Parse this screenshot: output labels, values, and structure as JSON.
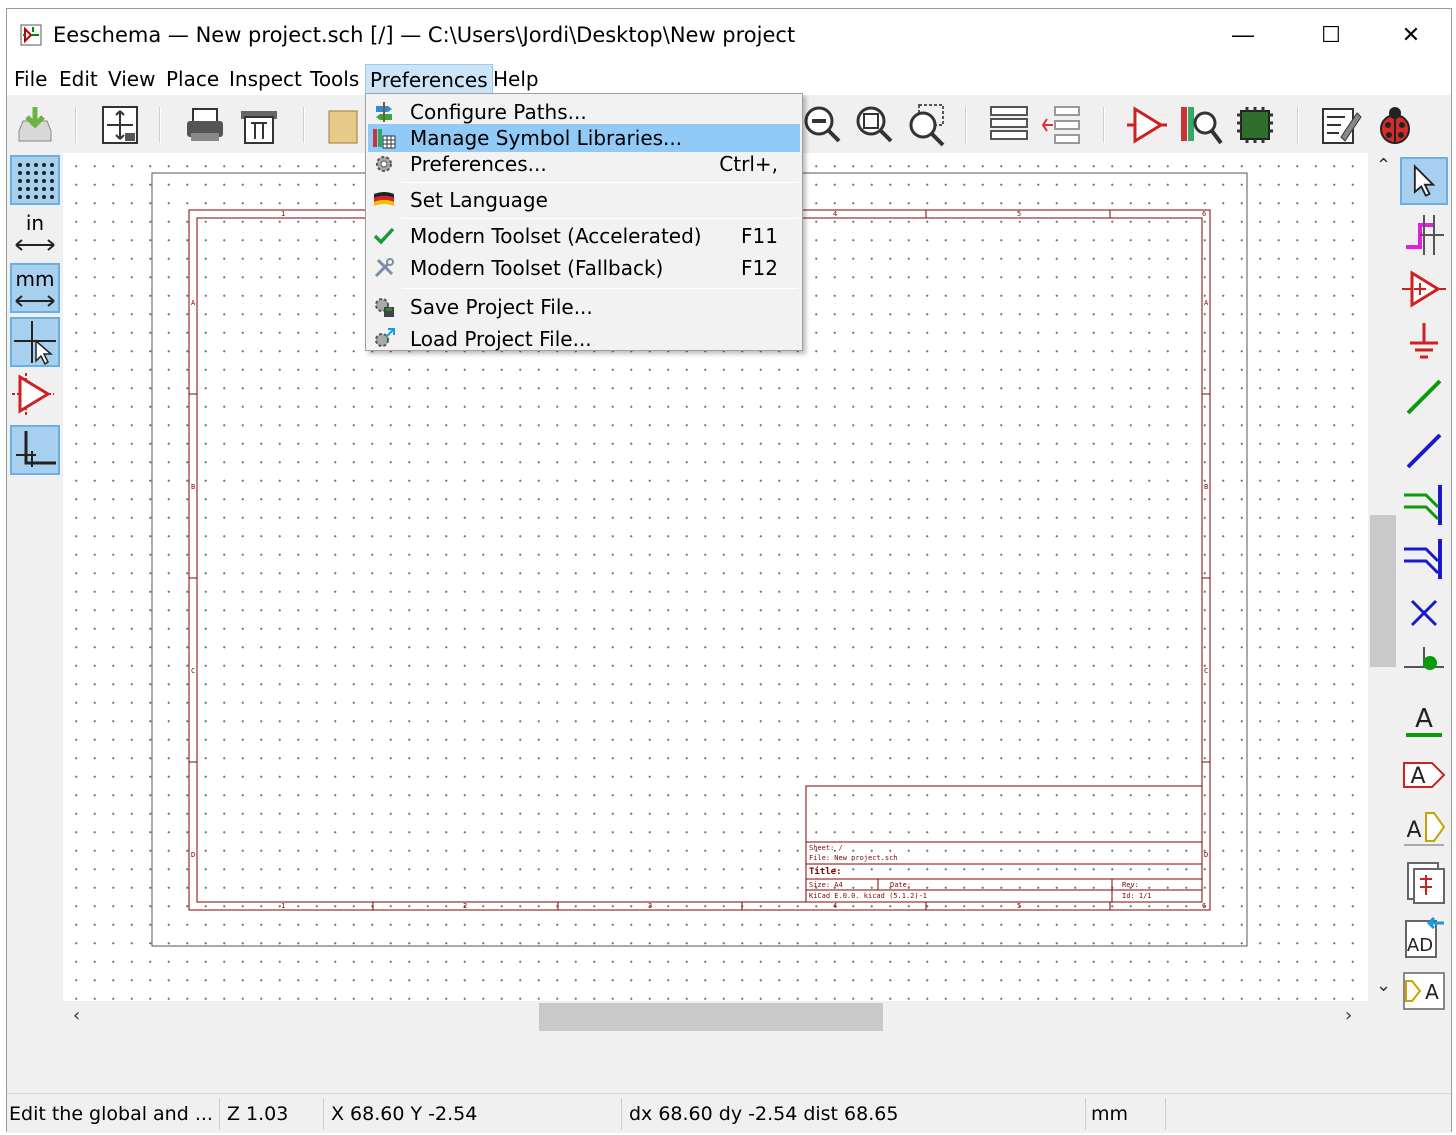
{
  "window": {
    "title": "Eeschema — New project.sch [/] — C:\\Users\\Jordi\\Desktop\\New project",
    "minimize_glyph": "—",
    "maximize_glyph": "☐",
    "close_glyph": "✕"
  },
  "menubar": {
    "items": [
      "File",
      "Edit",
      "View",
      "Place",
      "Inspect",
      "Tools",
      "Preferences",
      "Help"
    ],
    "active": "Preferences"
  },
  "preferences_menu": {
    "items": [
      {
        "label": "Configure Paths...",
        "shortcut": "",
        "icon": "configure-paths-icon"
      },
      {
        "label": "Manage Symbol Libraries...",
        "shortcut": "",
        "icon": "symbol-libraries-icon",
        "highlighted": true
      },
      {
        "label": "Preferences...",
        "shortcut": "Ctrl+,",
        "icon": "gear-icon"
      },
      {
        "label": "Set Language",
        "shortcut": "",
        "icon": "language-flag-icon"
      },
      {
        "label": "Modern Toolset (Accelerated)",
        "shortcut": "F11",
        "icon": "checkmark-icon",
        "checked": true
      },
      {
        "label": "Modern Toolset (Fallback)",
        "shortcut": "F12",
        "icon": "tools-icon"
      },
      {
        "label": "Save Project File...",
        "shortcut": "",
        "icon": "save-project-icon"
      },
      {
        "label": "Load Project File...",
        "shortcut": "",
        "icon": "load-project-icon"
      }
    ]
  },
  "left_toolbar": {
    "grid": "grid-toggle",
    "units_in": "in",
    "units_mm": "mm",
    "cursor": "full-crosshair-cursor",
    "hidden_pins": "show-hidden-pins",
    "h_v_only": "horizontal-vertical-only"
  },
  "sheet": {
    "title_block": {
      "sheet": "Sheet: /",
      "file": "File: New project.sch",
      "title": "Title:",
      "size": "Size: A4",
      "date": "Date:",
      "rev": "Rev:",
      "kicad": "KiCad E.0.0.  kicad (5.1.2)-1",
      "id": "Id: 1/1"
    },
    "col_labels": [
      "1",
      "2",
      "3",
      "4",
      "5",
      "6"
    ],
    "row_labels": [
      "A",
      "B",
      "C",
      "D"
    ]
  },
  "status": {
    "message": "Edit the global and ...",
    "zoom": "Z 1.03",
    "xy": "X 68.60  Y -2.54",
    "delta": "dx 68.60  dy -2.54  dist 68.65",
    "units": "mm"
  },
  "colors": {
    "menu_highlight": "#91c9f7",
    "sheet_border": "#840000",
    "toggle_on": "#a7cfee"
  }
}
